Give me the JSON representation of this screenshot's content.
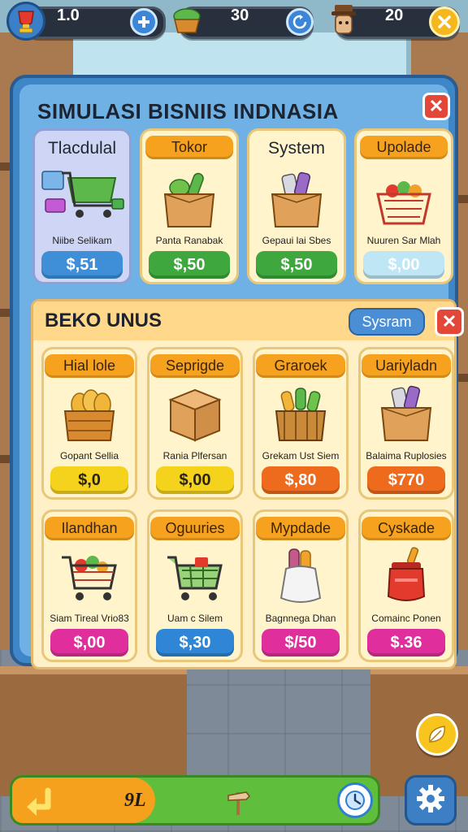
{
  "hud": {
    "level_value": "1.0",
    "cash_value": "30",
    "staff_value": "20",
    "icons": [
      "trophy-icon",
      "plus-icon",
      "vegetable-basket-icon",
      "refresh-icon",
      "shopkeeper-icon",
      "close-icon"
    ]
  },
  "panel": {
    "title": "SIMULASI BISNIIS INDNASIA",
    "close_label": "✕"
  },
  "top_cards": [
    {
      "label": "Tlacdulal",
      "sub": "Niibe Selikam",
      "price": "$,51",
      "price_color": "#3f8fd8",
      "art": "shop-goods-icon"
    },
    {
      "label": "Tokor",
      "sub": "Panta Ranabak",
      "price": "$,50",
      "price_color": "#3ea73d",
      "art": "vegetable-box-icon"
    },
    {
      "label": "System",
      "sub": "Gepaui lai Sbes",
      "price": "$,50",
      "price_color": "#3ea73d",
      "art": "goods-box-icon"
    },
    {
      "label": "Upolade",
      "sub": "Nuuren Sar Mlah",
      "price": "$,00",
      "price_color": "#bfe6f5",
      "art": "produce-basket-icon"
    }
  ],
  "section": {
    "title": "BEKO UNUS",
    "system_button": "Sysram",
    "close_label": "✕"
  },
  "grid_cards": [
    {
      "label": "Hial lole",
      "sub": "Gopant Sellia",
      "price": "$,0",
      "price_color": "#f5d21c",
      "price_text_color": "#2a2410",
      "art": "bread-crate-icon"
    },
    {
      "label": "Seprigde",
      "sub": "Rania Plfersan",
      "price": "$,00",
      "price_color": "#f5d21c",
      "price_text_color": "#2a2410",
      "art": "cardboard-box-icon"
    },
    {
      "label": "Graroek",
      "sub": "Grekam Ust Siem",
      "price": "$,80",
      "price_color": "#ee6a1c",
      "price_text_color": "#ffffff",
      "art": "vegetable-crate-icon"
    },
    {
      "label": "Uariyladn",
      "sub": "Balaima Ruplosies",
      "price": "$770",
      "price_color": "#ee6a1c",
      "price_text_color": "#ffffff",
      "art": "goods-box-icon"
    },
    {
      "label": "Ilandhan",
      "sub": "Siam Tireal Vrio83",
      "price": "$,00",
      "price_color": "#e02f9c",
      "price_text_color": "#ffffff",
      "art": "shopping-cart-icon"
    },
    {
      "label": "Oguuries",
      "sub": "Uam c Silem",
      "price": "$,30",
      "price_color": "#2f86d6",
      "price_text_color": "#ffffff",
      "art": "green-cart-icon"
    },
    {
      "label": "Mypdade",
      "sub": "Bagnnega Dhan",
      "price": "$/50",
      "price_color": "#e02f9c",
      "price_text_color": "#ffffff",
      "art": "sack-icon"
    },
    {
      "label": "Cyskade",
      "sub": "Comainc Ponen",
      "price": "$.36",
      "price_color": "#e02f9c",
      "price_text_color": "#ffffff",
      "art": "red-jar-icon"
    }
  ],
  "bottom": {
    "value": "9L",
    "icons": [
      "back-arrow-icon",
      "signpost-icon",
      "clock-icon",
      "gear-icon",
      "leaf-icon"
    ]
  }
}
